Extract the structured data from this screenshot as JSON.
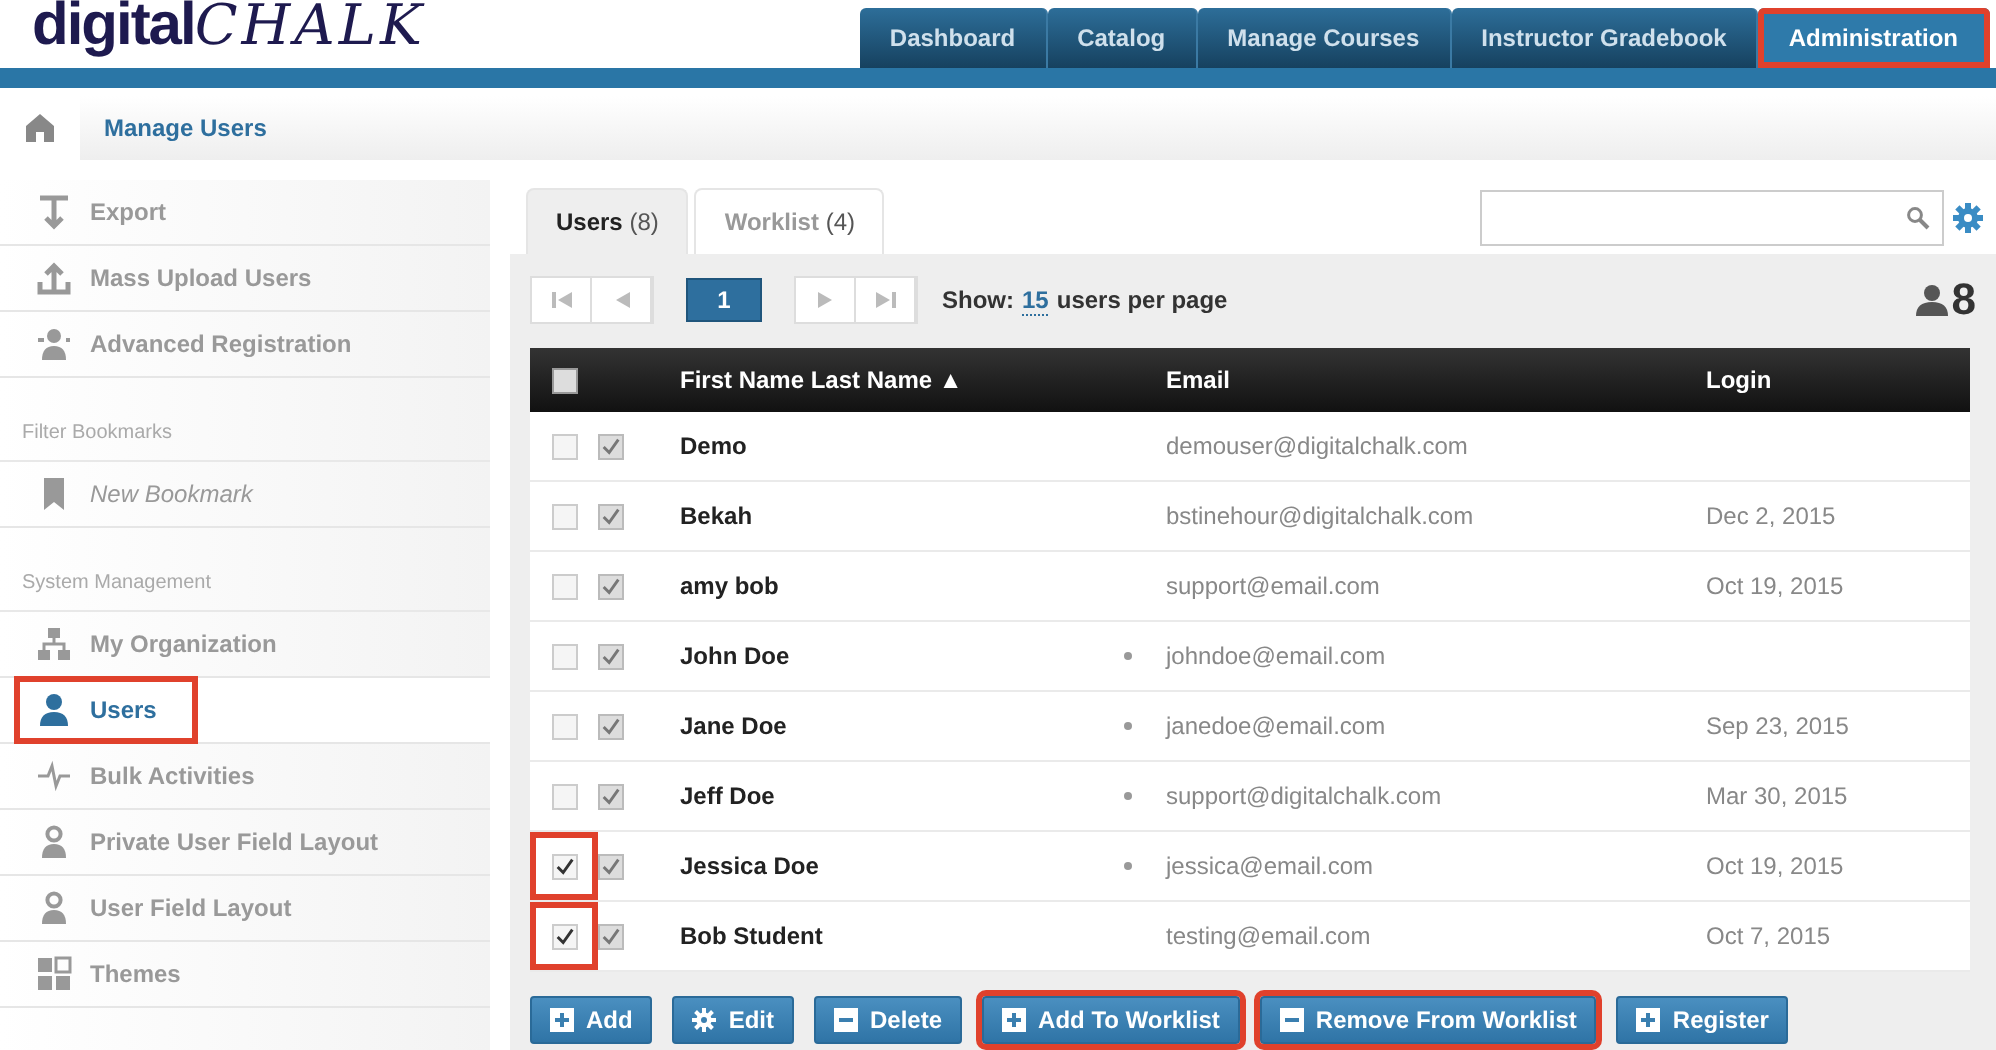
{
  "logo": {
    "text": "digital",
    "script_text": "CHALK"
  },
  "nav_tabs": [
    {
      "label": "Dashboard",
      "selected": false,
      "highlighted": false
    },
    {
      "label": "Catalog",
      "selected": false,
      "highlighted": false
    },
    {
      "label": "Manage Courses",
      "selected": false,
      "highlighted": false
    },
    {
      "label": "Instructor Gradebook",
      "selected": false,
      "highlighted": false
    },
    {
      "label": "Administration",
      "selected": true,
      "highlighted": true
    }
  ],
  "breadcrumb": {
    "title": "Manage Users"
  },
  "sidebar": [
    {
      "items": [
        {
          "label": "Export",
          "kind": "export",
          "selected": false,
          "italic": false,
          "highlighted": false
        },
        {
          "label": "Mass Upload Users",
          "kind": "upload",
          "selected": false,
          "italic": false,
          "highlighted": false
        },
        {
          "label": "Advanced Registration",
          "kind": "person-plus",
          "selected": false,
          "italic": false,
          "highlighted": false
        }
      ]
    },
    {
      "heading": "Filter Bookmarks",
      "items": [
        {
          "label": "New Bookmark",
          "kind": "bookmark",
          "selected": false,
          "italic": true,
          "highlighted": false
        }
      ]
    },
    {
      "heading": "System Management",
      "items": [
        {
          "label": "My Organization",
          "kind": "org",
          "selected": false,
          "italic": false,
          "highlighted": false
        },
        {
          "label": "Users",
          "kind": "person",
          "selected": true,
          "italic": false,
          "highlighted": true
        },
        {
          "label": "Bulk Activities",
          "kind": "pulse",
          "selected": false,
          "italic": false,
          "highlighted": false
        },
        {
          "label": "Private User Field Layout",
          "kind": "person-outline",
          "selected": false,
          "italic": false,
          "highlighted": false
        },
        {
          "label": "User Field Layout",
          "kind": "person-outline",
          "selected": false,
          "italic": false,
          "highlighted": false
        },
        {
          "label": "Themes",
          "kind": "grid",
          "selected": false,
          "italic": false,
          "highlighted": false
        }
      ]
    }
  ],
  "content_tabs": [
    {
      "label": "Users",
      "count": "(8)",
      "selected": true
    },
    {
      "label": "Worklist",
      "count": "(4)",
      "selected": false
    }
  ],
  "pager": {
    "page": "1",
    "show_label": "Show:",
    "per_page": "15",
    "per_page_suffix": "users per page",
    "total": "8"
  },
  "table": {
    "all_selected": false,
    "columns": [
      "First Name Last Name ▲",
      "Email",
      "Login"
    ],
    "rows": [
      {
        "name": "Demo",
        "email": "demouser@digitalchalk.com",
        "login": "",
        "selected": false,
        "enrolled": true,
        "flagged": false,
        "highlighted": false
      },
      {
        "name": "Bekah",
        "email": "bstinehour@digitalchalk.com",
        "login": "Dec 2, 2015",
        "selected": false,
        "enrolled": true,
        "flagged": false,
        "highlighted": false
      },
      {
        "name": "amy bob",
        "email": "support@email.com",
        "login": "Oct 19, 2015",
        "selected": false,
        "enrolled": true,
        "flagged": false,
        "highlighted": false
      },
      {
        "name": "John Doe",
        "email": "johndoe@email.com",
        "login": "",
        "selected": false,
        "enrolled": true,
        "flagged": true,
        "highlighted": false
      },
      {
        "name": "Jane Doe",
        "email": "janedoe@email.com",
        "login": "Sep 23, 2015",
        "selected": false,
        "enrolled": true,
        "flagged": true,
        "highlighted": false
      },
      {
        "name": "Jeff Doe",
        "email": "support@digitalchalk.com",
        "login": "Mar 30, 2015",
        "selected": false,
        "enrolled": true,
        "flagged": true,
        "highlighted": false
      },
      {
        "name": "Jessica Doe",
        "email": "jessica@email.com",
        "login": "Oct 19, 2015",
        "selected": true,
        "enrolled": true,
        "flagged": true,
        "highlighted": true
      },
      {
        "name": "Bob Student",
        "email": "testing@email.com",
        "login": "Oct 7, 2015",
        "selected": true,
        "enrolled": true,
        "flagged": false,
        "highlighted": true
      }
    ]
  },
  "actions": [
    {
      "label": "Add",
      "kind": "plus",
      "highlighted": false
    },
    {
      "label": "Edit",
      "kind": "gear",
      "highlighted": false
    },
    {
      "label": "Delete",
      "kind": "minus",
      "highlighted": false
    },
    {
      "label": "Add To Worklist",
      "kind": "plus",
      "highlighted": true
    },
    {
      "label": "Remove From Worklist",
      "kind": "minus",
      "highlighted": true
    },
    {
      "label": "Register",
      "kind": "plus",
      "highlighted": false
    }
  ]
}
